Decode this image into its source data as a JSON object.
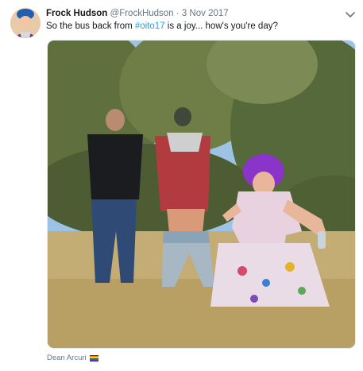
{
  "tweet": {
    "display_name": "Frock Hudson",
    "handle": "@FrockHudson",
    "separator": "·",
    "date": "3 Nov 2017",
    "text_before": "So the bus back from ",
    "hashtag": "#oito17",
    "text_after": " is a joy... how's you're day?"
  },
  "media": {
    "credit": "Dean Arcuri",
    "flag_icon": "rainbow-flag-icon"
  },
  "colors": {
    "link": "#1da1f2",
    "muted": "#657786"
  }
}
